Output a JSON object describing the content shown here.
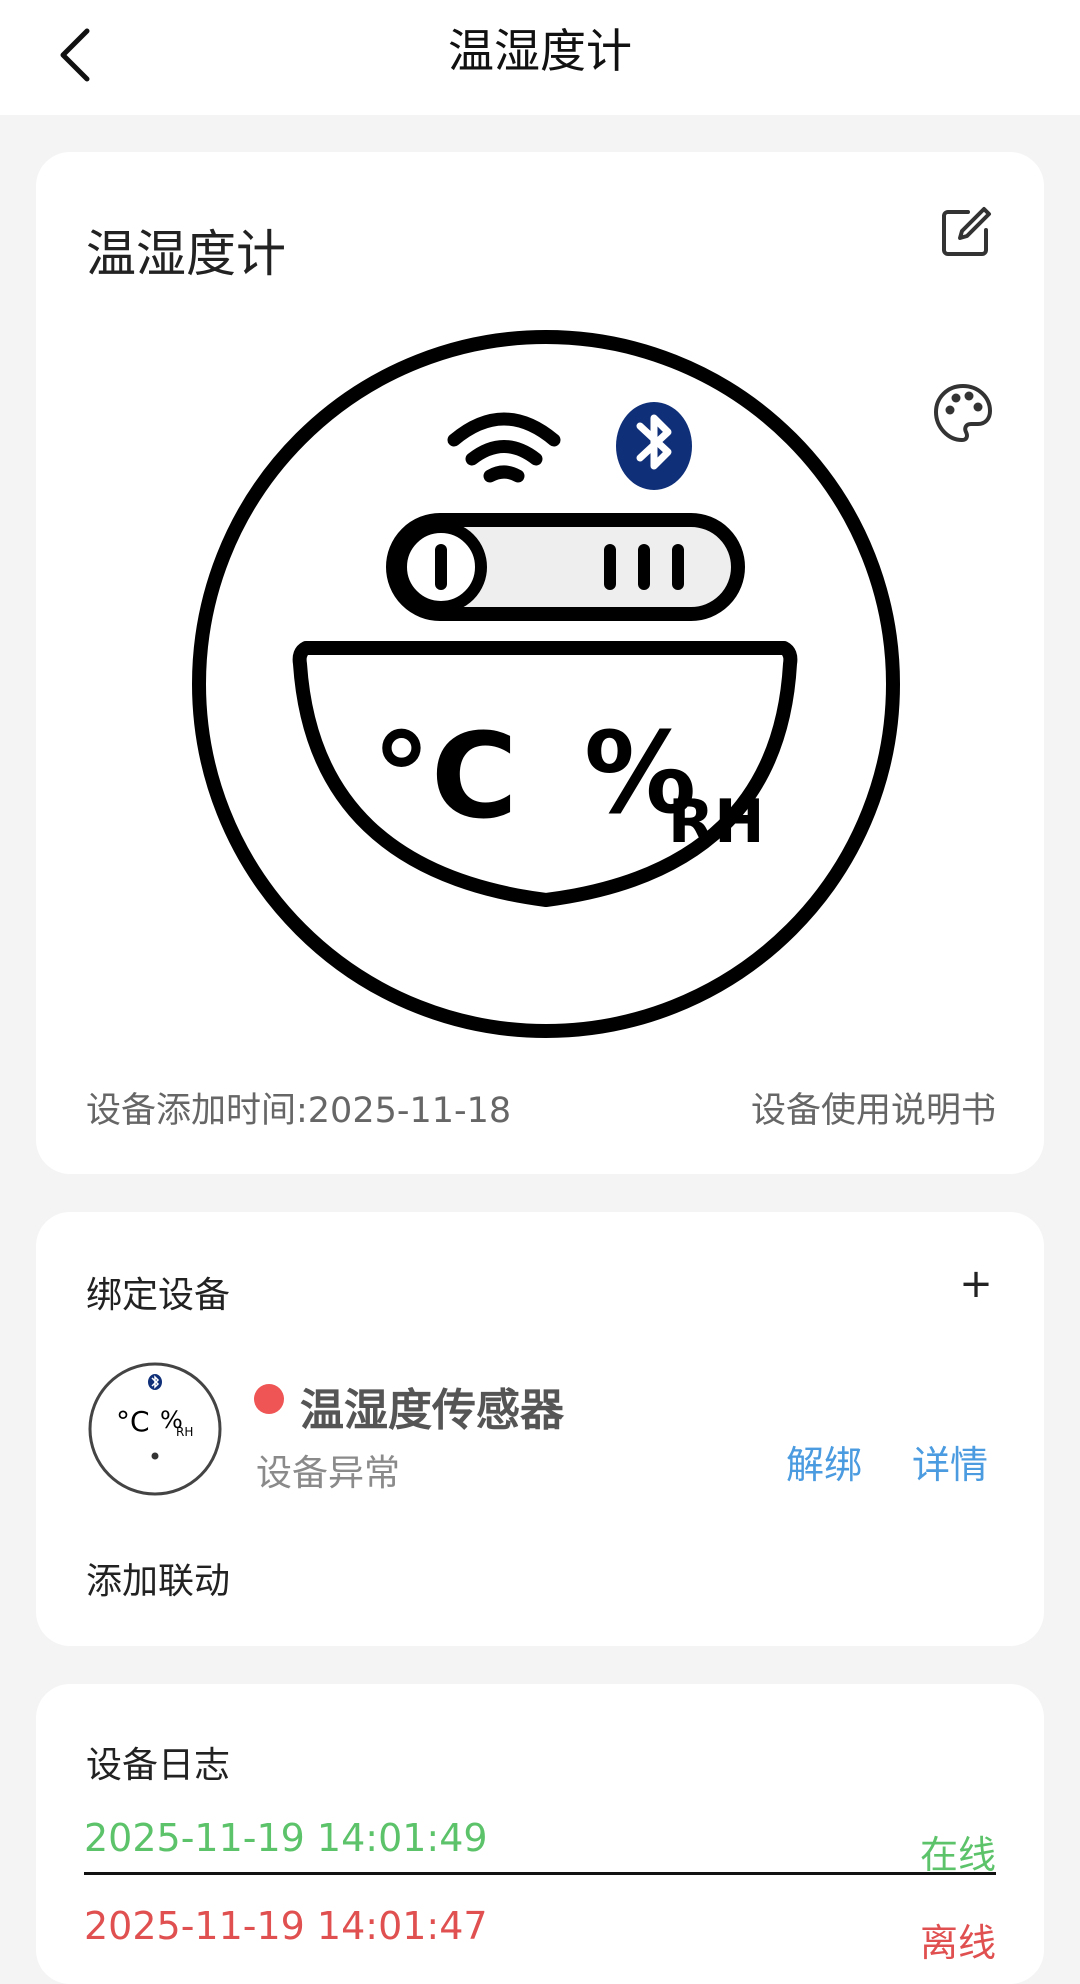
{
  "header": {
    "title": "温湿度计",
    "back_icon": "chevron-left-icon"
  },
  "device_card": {
    "title": "温湿度计",
    "edit_icon": "edit-icon",
    "palette_icon": "palette-icon",
    "illustration": {
      "wifi_icon": "wifi-icon",
      "bluetooth_icon": "bluetooth-icon",
      "temp_unit": "°C",
      "humidity_unit": "%",
      "humidity_suffix": "RH"
    },
    "added_time": "设备添加时间:2025-11-18",
    "manual_link": "设备使用说明书"
  },
  "bind_card": {
    "title": "绑定设备",
    "add_label": "+",
    "device": {
      "name": "温湿度传感器",
      "status": "设备异常",
      "status_color": "#f05555",
      "thumb_temp_unit": "°C",
      "thumb_humidity_unit": "%",
      "thumb_humidity_suffix": "RH"
    },
    "unbind_label": "解绑",
    "detail_label": "详情",
    "add_linkage_label": "添加联动"
  },
  "log_card": {
    "title": "设备日志",
    "entries": [
      {
        "time": "2025-11-19 14:01:49",
        "status": "在线",
        "color": "#5cc36a"
      },
      {
        "time": "2025-11-19 14:01:47",
        "status": "离线",
        "color": "#e05050"
      }
    ]
  },
  "colors": {
    "accent_link": "#4a9be0",
    "online": "#5cc36a",
    "offline": "#e05050",
    "bluetooth": "#0f2f78"
  }
}
